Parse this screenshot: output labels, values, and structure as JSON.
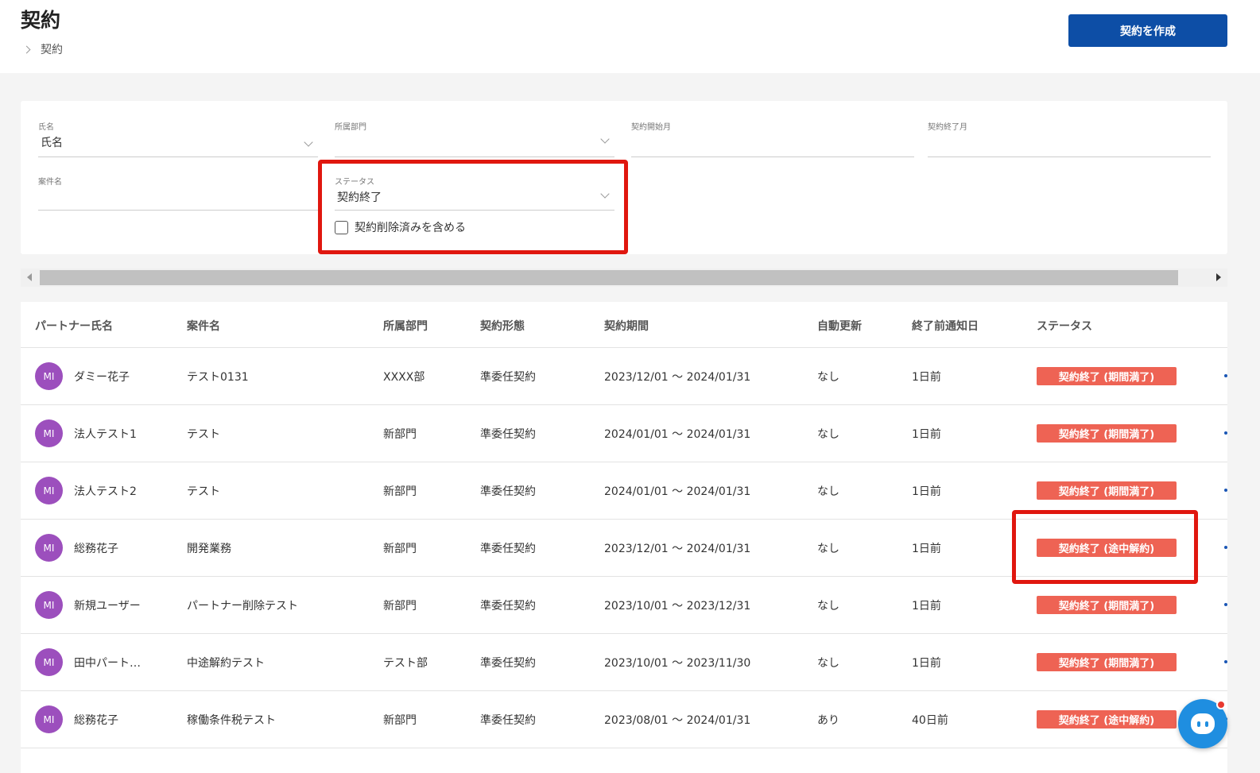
{
  "header": {
    "title": "契約",
    "breadcrumb": "契約",
    "create_button": "契約を作成"
  },
  "filters": {
    "name": {
      "label": "氏名",
      "value": "氏名"
    },
    "department": {
      "label": "所属部門",
      "value": ""
    },
    "start_month": {
      "label": "契約開始月",
      "value": ""
    },
    "end_month": {
      "label": "契約終了月",
      "value": ""
    },
    "project": {
      "label": "案件名",
      "value": ""
    },
    "status": {
      "label": "ステータス",
      "value": "契約終了"
    },
    "include_deleted": {
      "label": "契約削除済みを含める",
      "checked": false
    }
  },
  "table": {
    "headers": [
      "パートナー氏名",
      "案件名",
      "所属部門",
      "契約形態",
      "契約期間",
      "自動更新",
      "終了前通知日",
      "ステータス"
    ],
    "rows": [
      {
        "avatar": "MI",
        "name": "ダミー花子",
        "project": "テスト0131",
        "department": "XXXX部",
        "type": "準委任契約",
        "period": "2023/12/01 〜 2024/01/31",
        "auto_renew": "なし",
        "notice": "1日前",
        "status": "契約終了 (期間満了)"
      },
      {
        "avatar": "MI",
        "name": "法人テスト1",
        "project": "テスト",
        "department": "新部門",
        "type": "準委任契約",
        "period": "2024/01/01 〜 2024/01/31",
        "auto_renew": "なし",
        "notice": "1日前",
        "status": "契約終了 (期間満了)"
      },
      {
        "avatar": "MI",
        "name": "法人テスト2",
        "project": "テスト",
        "department": "新部門",
        "type": "準委任契約",
        "period": "2024/01/01 〜 2024/01/31",
        "auto_renew": "なし",
        "notice": "1日前",
        "status": "契約終了 (期間満了)"
      },
      {
        "avatar": "MI",
        "name": "総務花子",
        "project": "開発業務",
        "department": "新部門",
        "type": "準委任契約",
        "period": "2023/12/01 〜 2024/01/31",
        "auto_renew": "なし",
        "notice": "1日前",
        "status": "契約終了 (途中解約)"
      },
      {
        "avatar": "MI",
        "name": "新規ユーザー",
        "project": "パートナー削除テスト",
        "department": "新部門",
        "type": "準委任契約",
        "period": "2023/10/01 〜 2023/12/31",
        "auto_renew": "なし",
        "notice": "1日前",
        "status": "契約終了 (期間満了)"
      },
      {
        "avatar": "MI",
        "name": "田中パート…",
        "project": "中途解約テスト",
        "department": "テスト部",
        "type": "準委任契約",
        "period": "2023/10/01 〜 2023/11/30",
        "auto_renew": "なし",
        "notice": "1日前",
        "status": "契約終了 (期間満了)"
      },
      {
        "avatar": "MI",
        "name": "総務花子",
        "project": "稼働条件税テスト",
        "department": "新部門",
        "type": "準委任契約",
        "period": "2023/08/01 〜 2024/01/31",
        "auto_renew": "あり",
        "notice": "40日前",
        "status": "契約終了 (途中解約)"
      }
    ]
  },
  "colors": {
    "primary": "#0d4ea6",
    "badge": "#ee6354",
    "avatar": "#9c4fbd",
    "highlight": "#e0170f",
    "chat": "#1f8ee0"
  },
  "icons": [
    "chevron-right-icon",
    "chevron-down-icon",
    "chat-icon"
  ]
}
